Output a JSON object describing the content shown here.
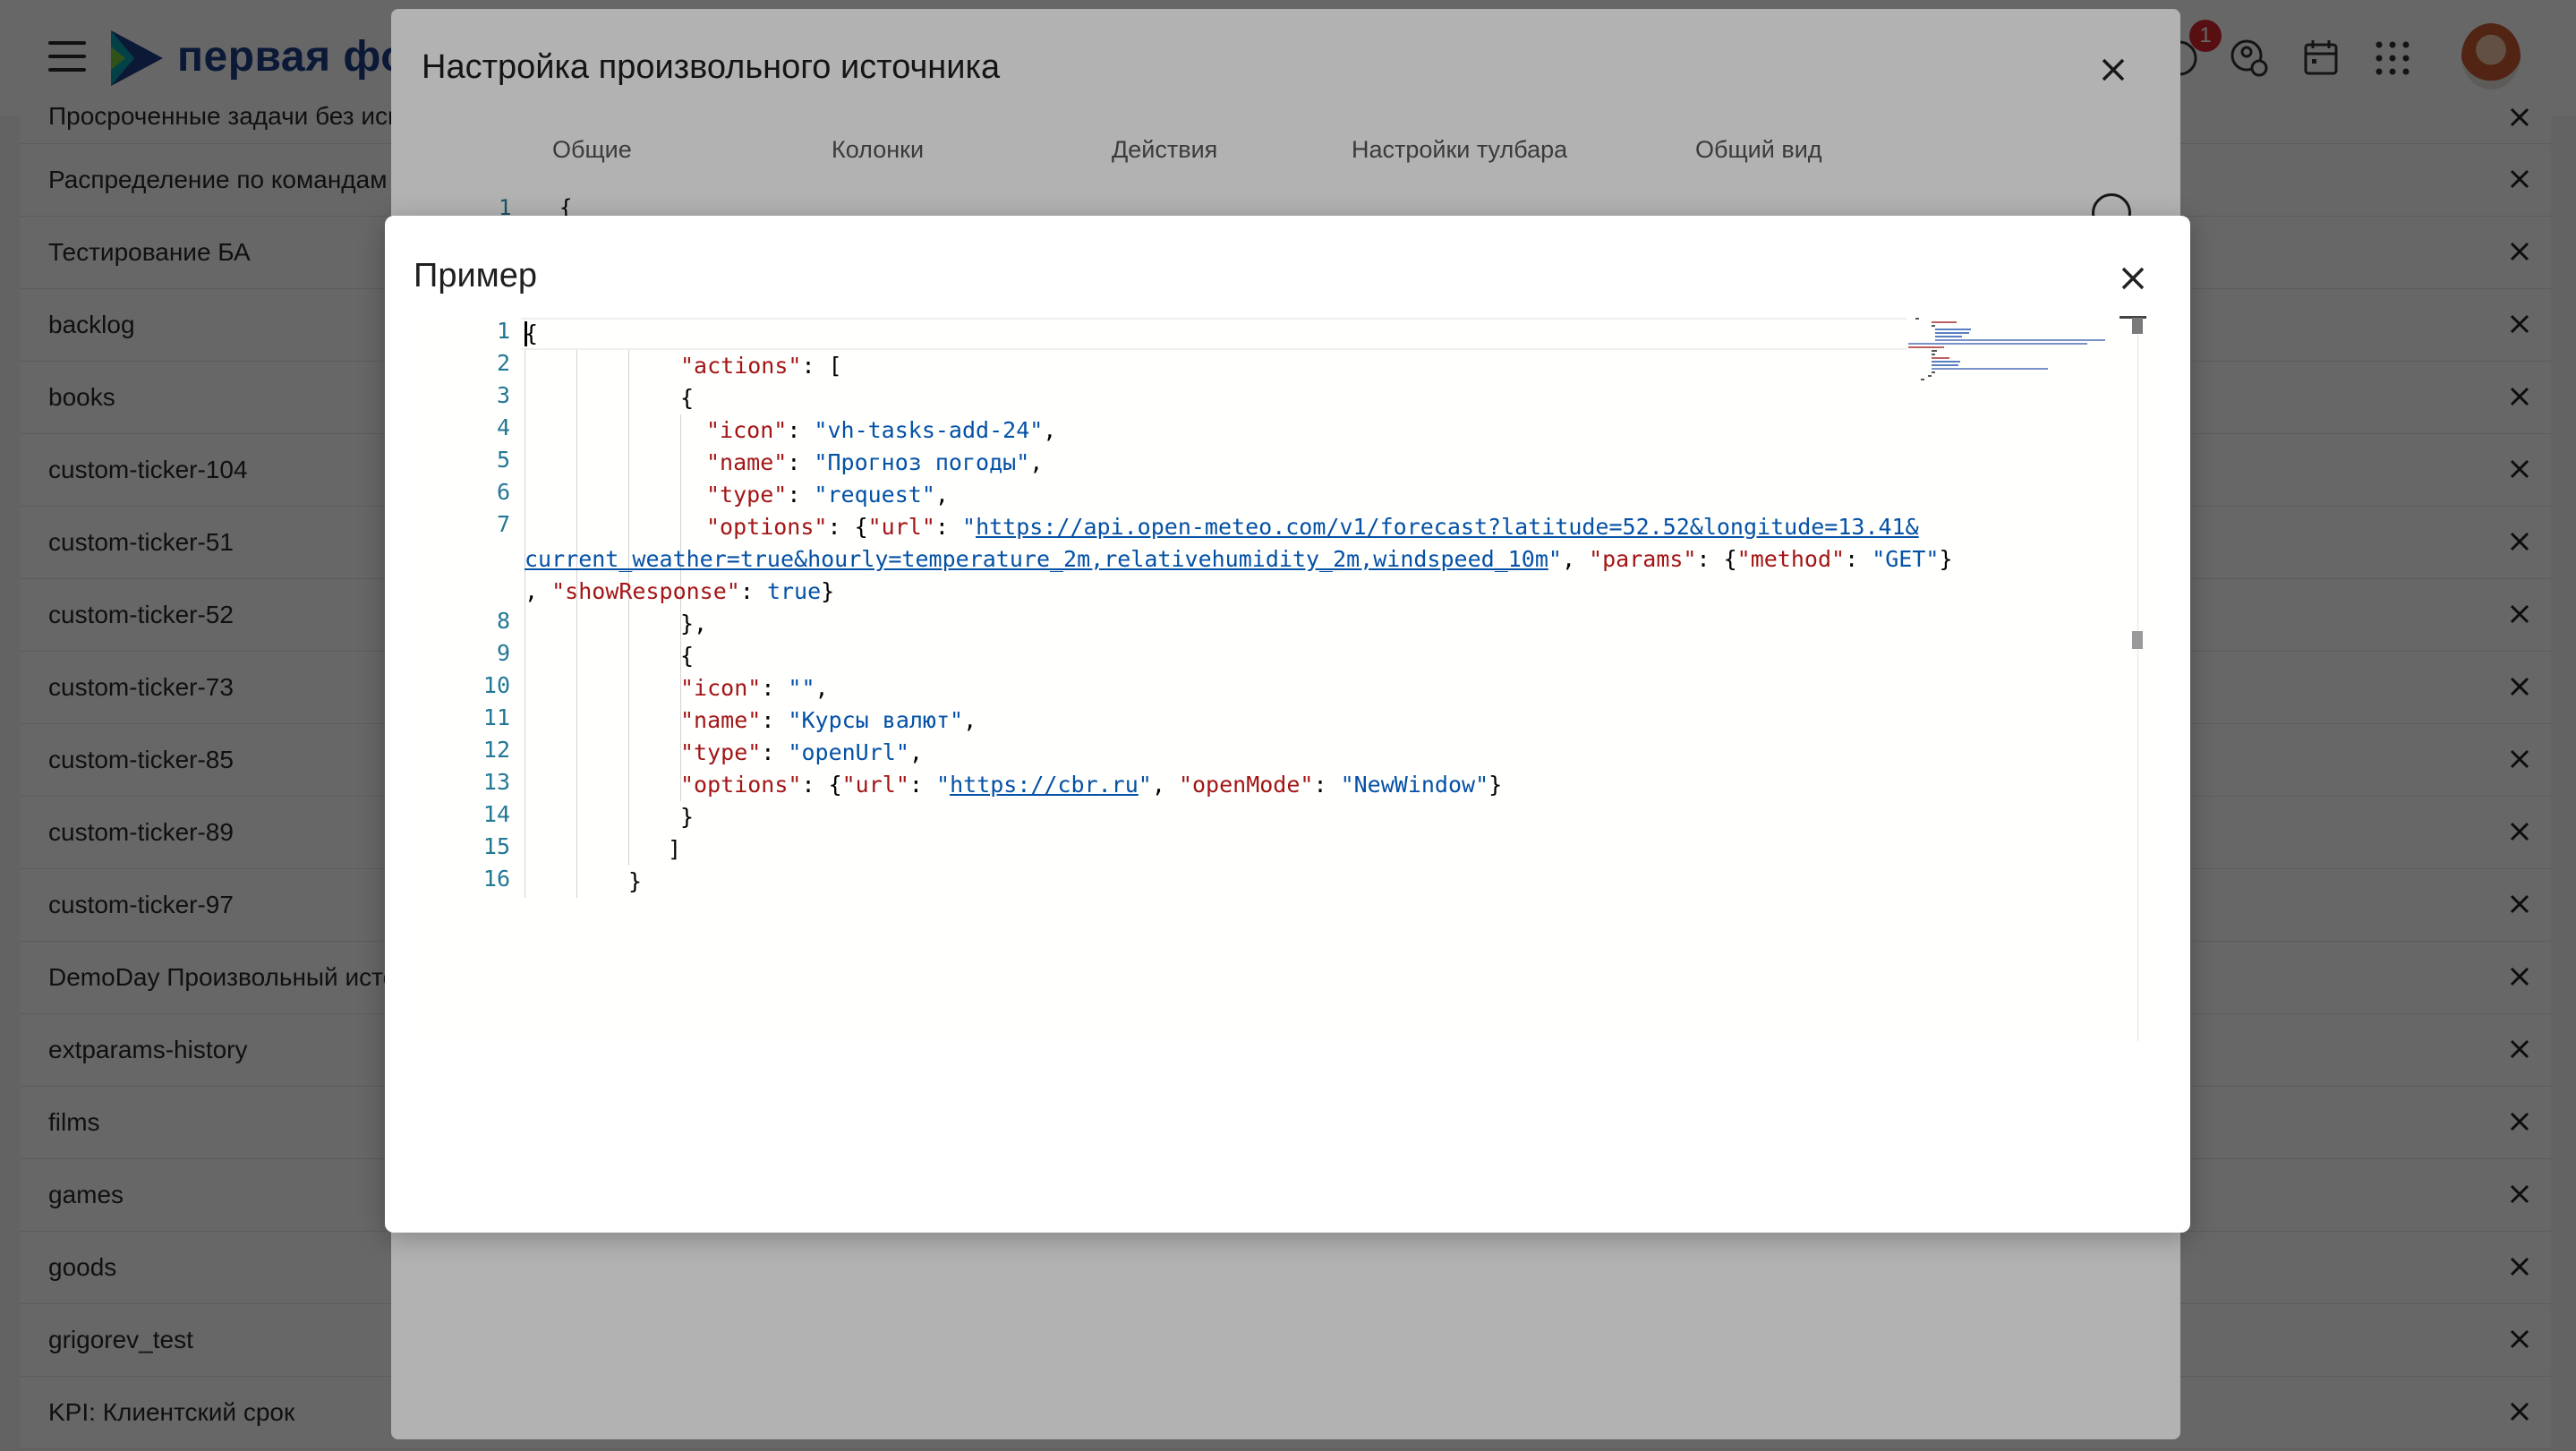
{
  "app": {
    "logo_text": "первая фор",
    "notification_count": "1"
  },
  "background_list": [
    "Просроченные задачи без исп",
    "Распределение по командам С",
    "Тестирование БА",
    "backlog",
    "books",
    "custom-ticker-104",
    "custom-ticker-51",
    "custom-ticker-52",
    "custom-ticker-73",
    "custom-ticker-85",
    "custom-ticker-89",
    "custom-ticker-97",
    "DemoDay Произвольный исто",
    "extparams-history",
    "films",
    "games",
    "goods",
    "grigorev_test",
    "KPI: Клиентский срок"
  ],
  "outer_modal": {
    "title": "Настройка произвольного источника",
    "tabs": [
      "Общие",
      "Колонки",
      "Действия",
      "Настройки тулбара",
      "Общий вид"
    ],
    "editor_line_number": "1",
    "editor_first_char": "{"
  },
  "inner_modal": {
    "title": "Пример",
    "line_numbers": [
      "1",
      "2",
      "3",
      "4",
      "5",
      "6",
      "7",
      "8",
      "9",
      "10",
      "11",
      "12",
      "13",
      "14",
      "15",
      "16"
    ],
    "code": {
      "l1": "{",
      "l2_key": "\"actions\"",
      "l2_rest": ": [",
      "l3": "{",
      "l4_key": "\"icon\"",
      "l4_val": "\"vh-tasks-add-24\"",
      "l5_key": "\"name\"",
      "l5_val": "\"Прогноз погоды\"",
      "l6_key": "\"type\"",
      "l6_val": "\"request\"",
      "l7_key": "\"options\"",
      "l7_urlkey": "\"url\"",
      "l7_url_part1": "https://api.open-meteo.com/v1/forecast?latitude=52.52&longitude=13.41&",
      "l7_url_part2": "current_weather=true&hourly=temperature_2m,relativehumidity_2m,windspeed_10m",
      "l7_params_key": "\"params\"",
      "l7_method_key": "\"method\"",
      "l7_method_val": "\"GET\"",
      "l7_show_key": "\"showResponse\"",
      "l7_show_val": "true",
      "l8": "},",
      "l9": "{",
      "l10_key": "\"icon\"",
      "l10_val": "\"\"",
      "l11_key": "\"name\"",
      "l11_val": "\"Курсы валют\"",
      "l12_key": "\"type\"",
      "l12_val": "\"openUrl\"",
      "l13_key": "\"options\"",
      "l13_urlkey": "\"url\"",
      "l13_url": "https://cbr.ru",
      "l13_mode_key": "\"openMode\"",
      "l13_mode_val": "\"NewWindow\"",
      "l14": "}",
      "l15": "]",
      "l16": "}"
    }
  },
  "colors": {
    "key": "#a31515",
    "string": "#0451a5",
    "line_number": "#237893",
    "logo": "#1d3f8a",
    "badge": "#d9272e"
  }
}
